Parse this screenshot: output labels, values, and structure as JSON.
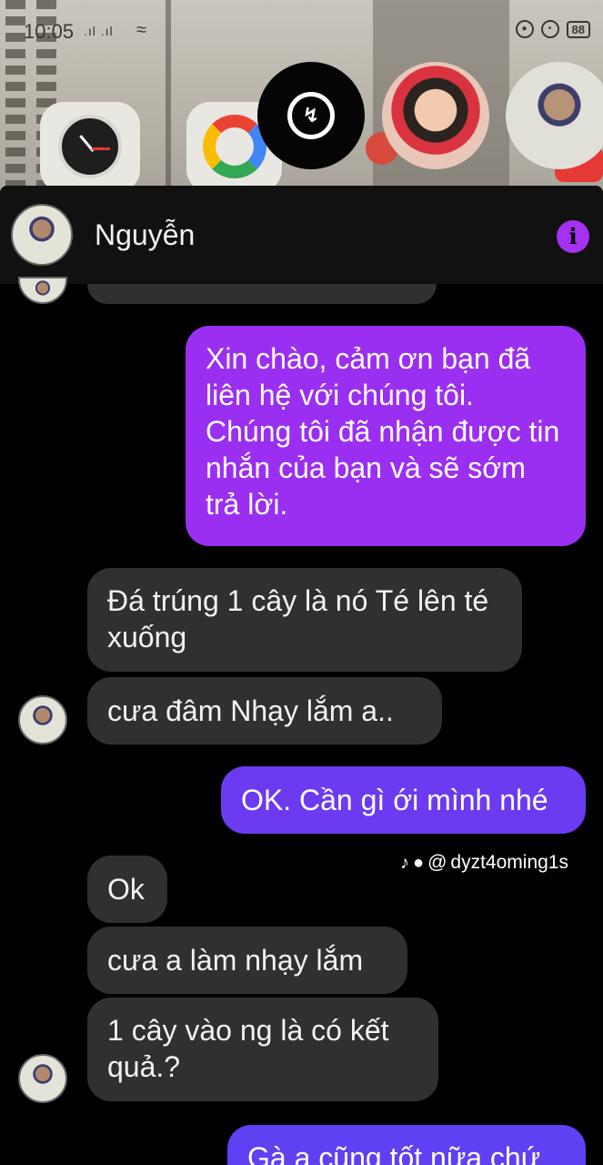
{
  "status_bar": {
    "time": "10:05",
    "signal": ".ıl .ıl",
    "wifi": "≈",
    "alarm": "⏰",
    "battery": "88"
  },
  "messenger_icon": "messenger-icon",
  "header": {
    "contact_name": "Nguyễn",
    "info": "i"
  },
  "messages": [
    {
      "side": "out",
      "text": "Xin chào, cảm ơn bạn đã liên hệ với chúng tôi. Chúng tôi đã nhận được tin nhắn của bạn và sẽ sớm trả lời."
    },
    {
      "side": "in",
      "text": "Đá trúng 1 cây là nó Té lên té xuống"
    },
    {
      "side": "in",
      "text": "cưa đâm Nhạy lắm a.."
    },
    {
      "side": "out",
      "text": "OK. Cần gì ới mình nhé"
    },
    {
      "side": "in",
      "text": "Ok"
    },
    {
      "side": "in",
      "text": "cưa a làm nhạy lắm"
    },
    {
      "side": "in",
      "text": "1 cây vào ng là có kết quả.?"
    },
    {
      "side": "out",
      "text": "Gà a cũng tốt nữa chứ"
    }
  ],
  "watermark": {
    "handle": "dyzt4oming1s"
  },
  "colors": {
    "out_top": "#9a2ff2",
    "out_bottom": "#6d3cf2",
    "incoming": "#303030",
    "accent": "#a431f3"
  }
}
